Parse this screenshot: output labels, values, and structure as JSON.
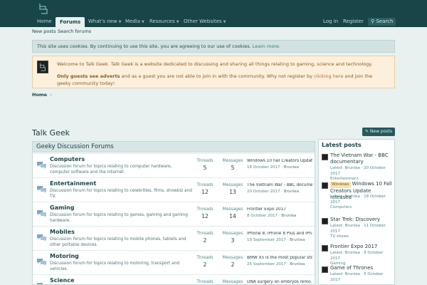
{
  "nav": {
    "items": [
      {
        "label": "Home",
        "caret": false
      },
      {
        "label": "Forums",
        "caret": false
      },
      {
        "label": "What's new",
        "caret": true
      },
      {
        "label": "Media",
        "caret": true
      },
      {
        "label": "Resources",
        "caret": true
      },
      {
        "label": "Other Websites",
        "caret": true
      }
    ],
    "login": "Log in",
    "register": "Register",
    "search": "Search"
  },
  "subnav": {
    "new_posts": "New posts",
    "search_forums": "Search forums"
  },
  "cookie_notice": {
    "text": "This site uses cookies. By continuing to use this site, you are agreeing to our use of cookies.",
    "link": "Learn more."
  },
  "welcome": {
    "line1": "Welcome to Talk Geek. Talk Geek is a website dedicated to discussing and sharing all things relating to gaming, science and technology.",
    "bold": "Only guests see adverts",
    "line2a": "and as a guest you are not able to join in with the community. Why not register by",
    "link": "clicking here",
    "line2b": "and join the geeky community today!"
  },
  "breadcrumb": {
    "home": "Home",
    "sep": "›"
  },
  "page_title": "Talk Geek",
  "new_posts_button": "New posts",
  "forum_block": {
    "title": "Geeky Discussion Forums",
    "forums": [
      {
        "title": "Computers",
        "desc": "Discussion forum for topics relating to computer hardware, computer software and the internet.",
        "threads_label": "Threads",
        "threads": "5",
        "messages_label": "Messages",
        "messages": "5",
        "last_title": "Windows 10 Fall Creators Updat...",
        "last_date": "18 October 2017",
        "last_user": "Brunlea"
      },
      {
        "title": "Entertainment",
        "desc": "Discussion forum for topics relating to celebrities, films, showbiz and TV.",
        "threads_label": "Threads",
        "threads": "12",
        "messages_label": "Messages",
        "messages": "13",
        "last_title": "The Vietnam War - BBC docume...",
        "last_date": "20 October 2017",
        "last_user": "Brunlea"
      },
      {
        "title": "Gaming",
        "desc": "Discussion forum for topics relating to games, gaming and gaming hardware.",
        "threads_label": "Threads",
        "threads": "12",
        "messages_label": "Messages",
        "messages": "14",
        "last_title": "Frontier Expo 2017",
        "last_date": "8 October 2017",
        "last_user": "Brunlea"
      },
      {
        "title": "Mobiles",
        "desc": "Discussion forum for topics relating to mobile phones, tablets and other portable devices.",
        "threads_label": "Threads",
        "threads": "2",
        "messages_label": "Messages",
        "messages": "3",
        "last_title": "iPhone 8, iPhone 8 Plus and iPh...",
        "last_date": "19 September 2017",
        "last_user": "Brunlea"
      },
      {
        "title": "Motoring",
        "desc": "Discussion forum for topics relating to motoring, transport and vehicles.",
        "threads_label": "Threads",
        "threads": "2",
        "messages_label": "Messages",
        "messages": "2",
        "last_title": "BMW X5 is the most popular sto...",
        "last_date": "25 September 2017",
        "last_user": "Brunlea"
      },
      {
        "title": "Science",
        "desc": "",
        "threads_label": "Threads",
        "threads": "",
        "messages_label": "Messages",
        "messages": "",
        "last_title": "DNA surgery on embryos remo...",
        "last_date": "",
        "last_user": ""
      }
    ]
  },
  "latest_posts": {
    "title": "Latest posts",
    "items": [
      {
        "prefix": "",
        "title": "The Vietnam War - BBC documentary",
        "meta": "Latest: Brunlea · 20 October 2017",
        "forum": "Entertainment"
      },
      {
        "prefix": "Windows",
        "title": "Windows 10 Fall Creators Update released",
        "meta": "Latest: Brunlea · 18 October 2017",
        "forum": "Computers"
      },
      {
        "prefix": "",
        "title": "Star Trek: Discovery",
        "meta": "Latest: Brunlea · 11 October 2017",
        "forum": "TV shows"
      },
      {
        "prefix": "",
        "title": "Frontier Expo 2017",
        "meta": "Latest: Brunlea · 8 October 2017",
        "forum": "Gaming"
      },
      {
        "prefix": "",
        "title": "Game of Thrones",
        "meta": "Latest: Brunlea · 5 October 2017",
        "forum": ""
      }
    ]
  },
  "colors": {
    "header": "#184547",
    "accent": "#2b7f84",
    "notice_bg": "#fcf0dc",
    "notice_text": "#8a5a1e"
  }
}
